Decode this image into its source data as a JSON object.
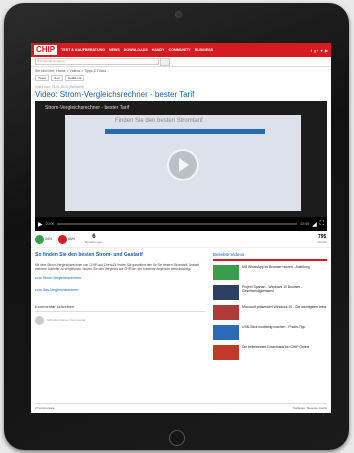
{
  "header": {
    "logo": "CHIP",
    "nav": [
      "TEST & KAUFBERATUNG",
      "NEWS",
      "DOWNLOADS",
      "HANDY",
      "COMMUNITY",
      "BUSINESS"
    ],
    "social": [
      "f",
      "g+",
      "♥",
      "▶"
    ]
  },
  "search": {
    "placeholder": "Suchbegriff eingeben"
  },
  "breadcrumb": "Sie sind hier: Home > Videos > Tipps & Tricks",
  "share": {
    "tweet": "Tweet",
    "gplus": "G+1",
    "like": "Gefällt mir"
  },
  "video": {
    "meta": "Video vom: 24.01.2013 (Verifiziert)",
    "title": "Video: Strom-Vergleichsrechner - bester Tarif",
    "player_title": "Strom-Vergleichsrechner - bester Tarif",
    "frame_heading": "Finden Sie den besten Stromtarif",
    "time_current": "00:00",
    "time_total": "02:05"
  },
  "rating": {
    "up": "34%",
    "down": "66%",
    "votes": "6",
    "votes_label": "Bewertungen",
    "views": "795",
    "views_label": "Aufrufe"
  },
  "article": {
    "heading": "So finden Sie den besten Strom- und Gastarif",
    "body": "Mit dem Strom-Vergleichsrechner von CHIP und Check24 finden Sie garantiert den für Sie besten Stromtarif. Anstatt mehrere Anbieter zu vergleichen, nutzen Sie den Vergleich auf CHIP.de, der hunderte Angebote berücksichtigt.",
    "link1": "zum Strom-Vergleichsrechner",
    "link2": "zum Gas-Vergleichsrechner"
  },
  "comments": {
    "heading": "Kommentar schreiben",
    "placeholder": "Schreibe Deinen Kommentar...",
    "count": "2 Kommentare",
    "sort": "Sortieren: Neueste zuerst"
  },
  "related": {
    "heading": "Beliebte Videos",
    "items": [
      {
        "title": "MS WhatsApp im Browser nutzen - Anleitung",
        "color": "#3a9d4c"
      },
      {
        "title": "Project Spartan - Windows 10 Browser - Geschwindigkeitstest",
        "color": "#2d3f63"
      },
      {
        "title": "Microsoft präsentiert Windows 10 - Die wichtigsten Infos",
        "color": "#b03a3a"
      },
      {
        "title": "USB-Stick bootfähig machen - Praxis-Tipp",
        "color": "#2a6ab8"
      },
      {
        "title": "Die beliebtesten Downloads bei CHIP Online",
        "color": "#c0392b"
      }
    ]
  },
  "colors": {
    "brand": "#d71a21",
    "link": "#1a5ea8"
  }
}
